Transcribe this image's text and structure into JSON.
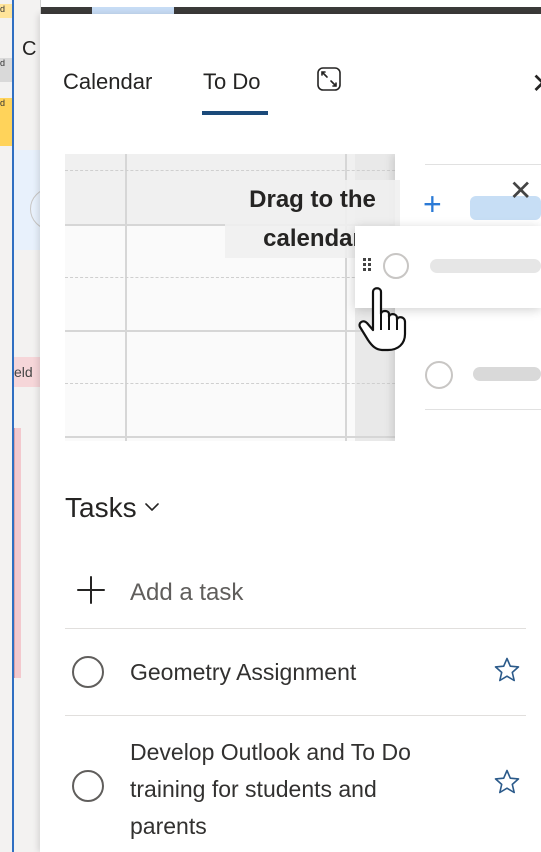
{
  "background": {
    "chips": [
      "d",
      "d",
      "d"
    ],
    "letter": "C",
    "pill_text": "eld"
  },
  "tabs": [
    {
      "label": "Calendar",
      "active": false
    },
    {
      "label": "To Do",
      "active": true
    }
  ],
  "colors": {
    "accent": "#1b4a7a",
    "add_blue": "#2b7ad6",
    "divider": "#e1dfdd"
  },
  "illustration": {
    "drag_text": "Drag to the calendar"
  },
  "tasks": {
    "header": "Tasks",
    "add_placeholder": "Add a task",
    "items": [
      {
        "title": "Geometry Assignment",
        "important": false
      },
      {
        "title": "Develop Outlook and To Do training for students and parents",
        "important": false
      }
    ]
  },
  "icons": [
    "expand-icon",
    "close-icon",
    "chevron-down-icon",
    "plus-icon",
    "star-icon",
    "drag-handle-icon",
    "hand-cursor-icon"
  ]
}
